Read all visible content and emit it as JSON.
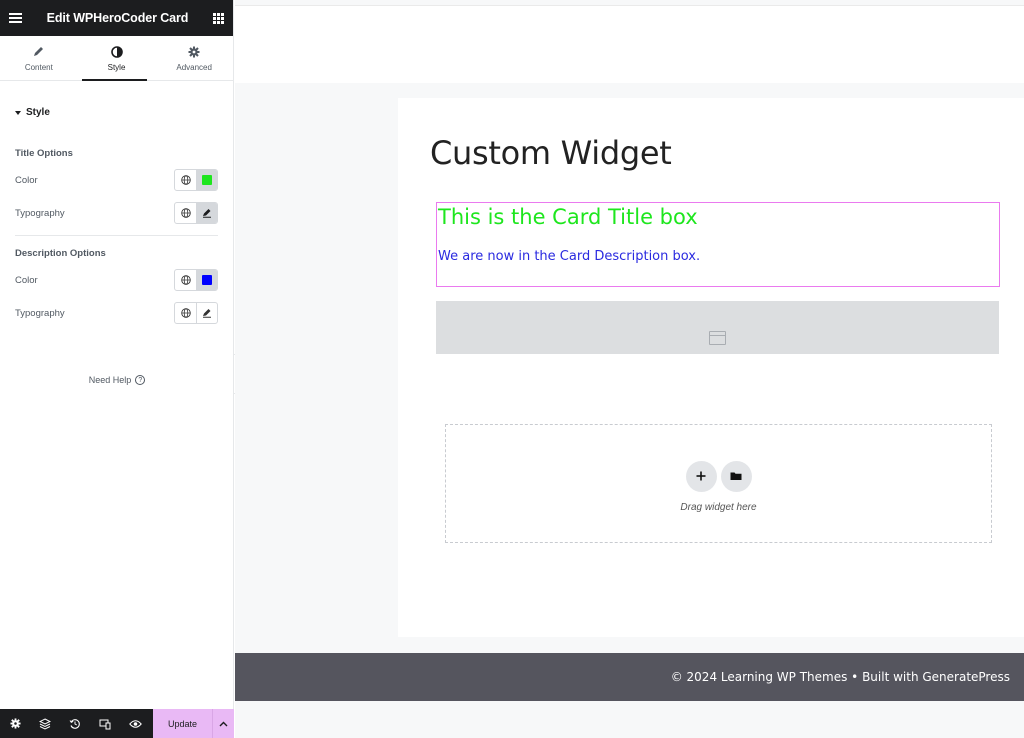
{
  "panel": {
    "title": "Edit WPHeroCoder Card",
    "tabs": [
      {
        "label": "Content",
        "icon": "pencil-icon"
      },
      {
        "label": "Style",
        "icon": "half-circle-icon"
      },
      {
        "label": "Advanced",
        "icon": "gear-icon"
      }
    ],
    "active_tab": "Style",
    "section_label": "Style",
    "title_options": {
      "heading": "Title Options",
      "color_label": "Color",
      "color_value": "#1ee61e",
      "typography_label": "Typography"
    },
    "description_options": {
      "heading": "Description Options",
      "color_label": "Color",
      "color_value": "#0000ff",
      "typography_label": "Typography"
    },
    "need_help": "Need Help",
    "footer": {
      "icons": [
        "gear-icon",
        "layers-icon",
        "history-icon",
        "responsive-icon",
        "eye-icon"
      ],
      "update_label": "Update"
    }
  },
  "preview": {
    "page_heading": "Custom Widget",
    "card_title": "This is the Card Title box",
    "card_description": "We are now in the Card Description box.",
    "drop_zone_label": "Drag widget here",
    "footer_text": "© 2024 Learning WP Themes • Built with GeneratePress"
  },
  "colors": {
    "panel_dark": "#1c1d1f",
    "update_button": "#e9b9f5",
    "selection_outline": "#ea7aef",
    "footer_bg": "#55555e"
  }
}
